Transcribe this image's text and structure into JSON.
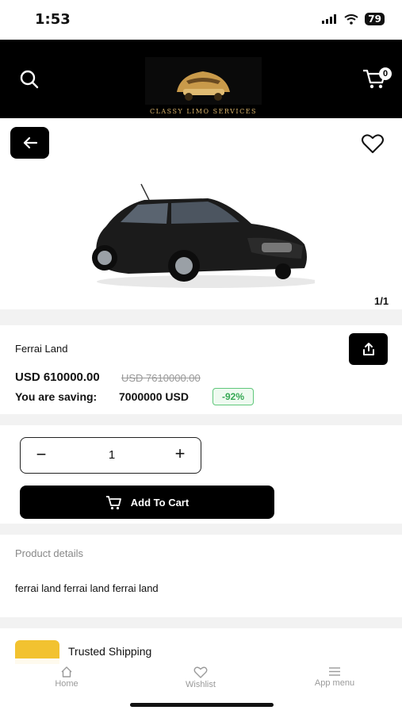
{
  "status": {
    "time": "1:53",
    "battery": "79"
  },
  "header": {
    "logo_text": "CLASSY LIMO SERVICES",
    "cart_count": "0"
  },
  "gallery": {
    "counter": "1/1"
  },
  "product": {
    "name": "Ferrai Land",
    "price": "USD 610000.00",
    "old_price": "USD 7610000.00",
    "saving_label": "You are saving:",
    "saving_value": "7000000 USD",
    "discount": "-92%"
  },
  "quantity": {
    "minus": "−",
    "value": "1",
    "plus": "+"
  },
  "actions": {
    "add_to_cart": "Add To Cart"
  },
  "details": {
    "title": "Product details",
    "text": "ferrai land ferrai land ferrai land"
  },
  "shipping": {
    "label": "Trusted Shipping"
  },
  "nav": {
    "home": "Home",
    "wishlist": "Wishlist",
    "menu": "App menu"
  },
  "colors": {
    "header_bg": "#000000",
    "accent_yellow": "#f2c230",
    "discount_green": "#35a853"
  }
}
